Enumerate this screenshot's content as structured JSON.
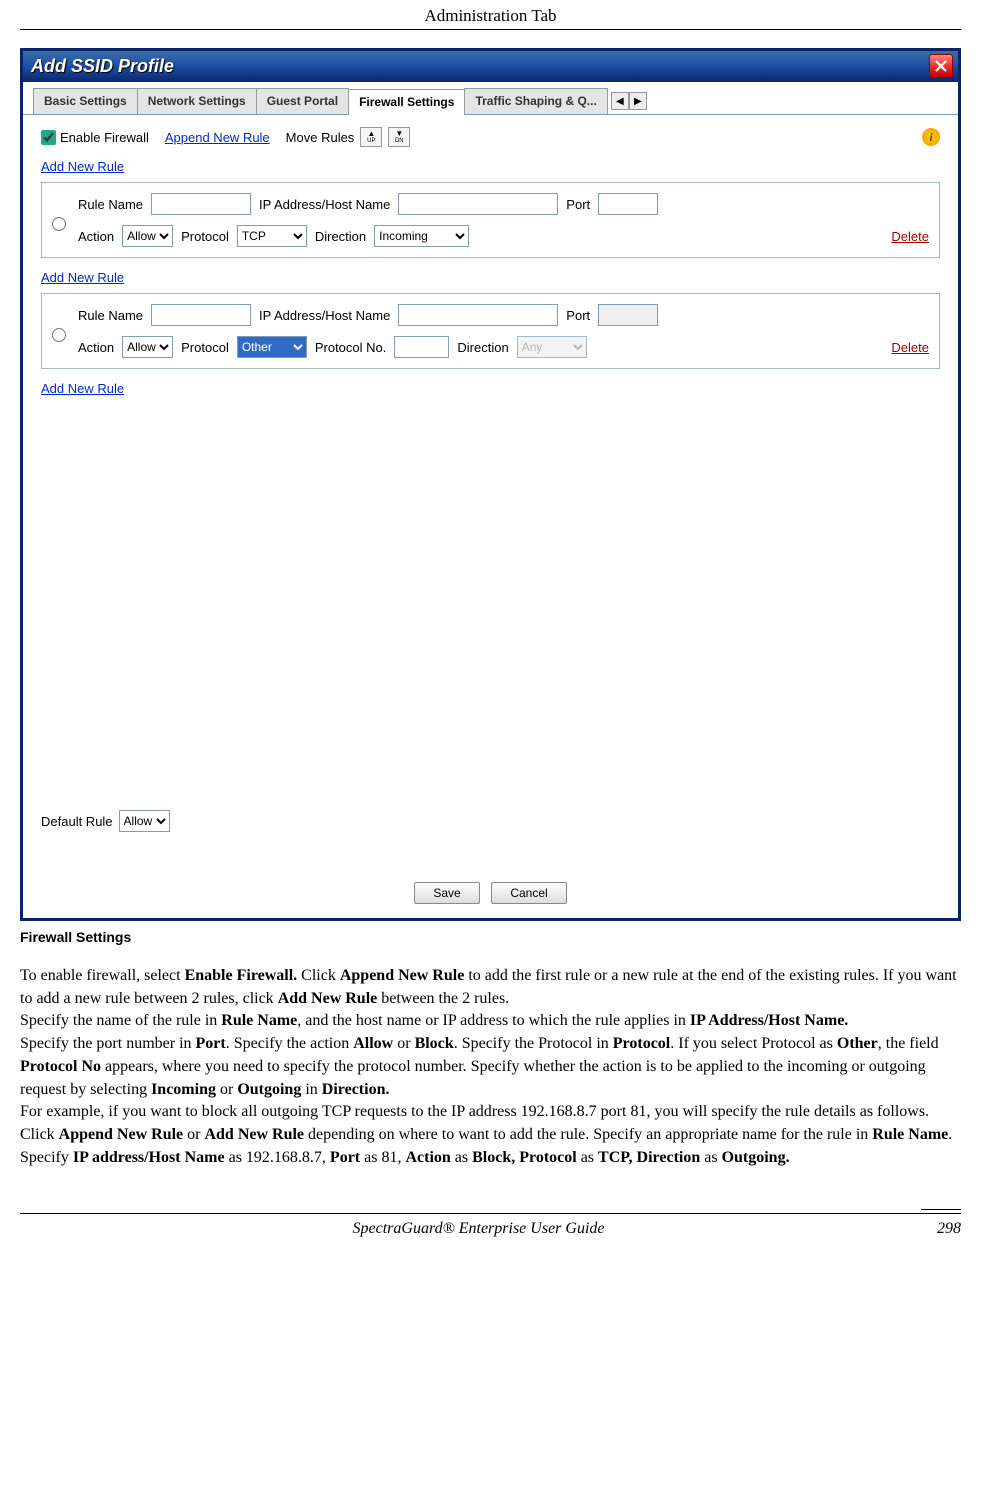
{
  "header": {
    "title": "Administration Tab"
  },
  "window": {
    "title": "Add SSID Profile",
    "tabs": [
      "Basic Settings",
      "Network Settings",
      "Guest Portal",
      "Firewall Settings",
      "Traffic Shaping & Q..."
    ],
    "active_tab_index": 3
  },
  "toolbar": {
    "enable_label": "Enable Firewall",
    "enable_checked": true,
    "append_link": "Append New Rule",
    "move_label": "Move Rules",
    "up_label": "UP",
    "dn_label": "DN"
  },
  "rule_section": {
    "add_link": "Add New Rule",
    "labels": {
      "rule_name": "Rule Name",
      "ip_host": "IP Address/Host Name",
      "port": "Port",
      "action": "Action",
      "protocol": "Protocol",
      "direction": "Direction",
      "protocol_no": "Protocol No.",
      "delete": "Delete"
    },
    "rule1": {
      "action": "Allow",
      "protocol": "TCP",
      "direction": "Incoming"
    },
    "rule2": {
      "action": "Allow",
      "protocol": "Other",
      "direction": "Any"
    }
  },
  "footer_controls": {
    "default_label": "Default Rule",
    "default_value": "Allow",
    "save": "Save",
    "cancel": "Cancel"
  },
  "caption": "Firewall Settings",
  "doc": {
    "p1a": "To enable firewall, select ",
    "p1b": "Enable Firewall.",
    "p1c": " Click ",
    "p1d": "Append New Rule",
    "p1e": " to add the first rule or a new rule at the end of the existing rules. If you want to add a new rule between 2 rules, click  ",
    "p1f": "Add New Rule",
    "p1g": " between the 2 rules.",
    "p2a": "Specify the name of the rule in ",
    "p2b": "Rule Name",
    "p2c": ", and the host name or IP address to which the rule applies in ",
    "p2d": "IP Address/Host Name.",
    "p3a": "Specify the port number in ",
    "p3b": "Port",
    "p3c": ". Specify the action ",
    "p3d": "Allow",
    "p3e": " or ",
    "p3f": "Block",
    "p3g": ". Specify the Protocol in ",
    "p3h": "Protocol",
    "p3i": ". If you select Protocol as ",
    "p3j": "Other",
    "p3k": ", the field ",
    "p3l": "Protocol No",
    "p3m": " appears, where you need to specify the protocol number. Specify whether the action is to be applied to the incoming or outgoing request by selecting ",
    "p3n": "Incoming",
    "p3o": " or ",
    "p3p": "Outgoing",
    "p3q": " in ",
    "p3r": "Direction.",
    "p4a": " For example, if you want to block all outgoing TCP requests to the IP address 192.168.8.7 port 81, you will specify the rule details as follows. Click ",
    "p4b": "Append New Rule",
    "p4c": " or ",
    "p4d": "Add New Rule",
    "p4e": "  depending on where to want to add the rule. Specify an appropriate name for the rule in ",
    "p4f": "Rule Name",
    "p4g": ". Specify ",
    "p4h": "IP address/Host Name",
    "p4i": " as 192.168.8.7, ",
    "p4j": "Port",
    "p4k": " as 81, ",
    "p4l": "Action",
    "p4m": " as ",
    "p4n": "Block, Protocol",
    "p4o": " as ",
    "p4p": "TCP, Direction",
    "p4q": " as ",
    "p4r": "Outgoing."
  },
  "page_footer": {
    "guide": "SpectraGuard®  Enterprise User Guide",
    "page": "298"
  }
}
